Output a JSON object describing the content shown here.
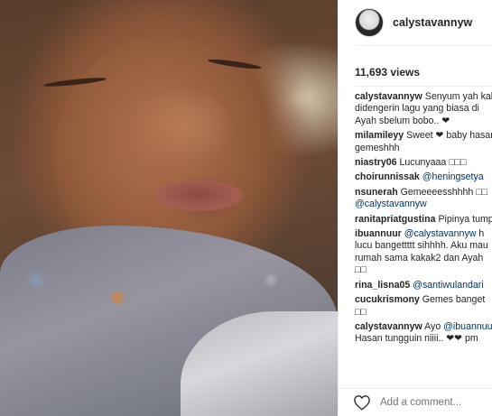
{
  "post": {
    "username": "calystavannyw",
    "views": "11,693 views"
  },
  "comments": [
    {
      "user": "calystavannyw",
      "lines": [
        "Senyum yah kalau",
        "didengerin lagu yang biasa di",
        "Ayah sbelum bobo.. ❤"
      ]
    },
    {
      "user": "milamileyy",
      "lines": [
        "Sweet ❤ baby hasan",
        "gemeshhh"
      ]
    },
    {
      "user": "niastry06",
      "lines": [
        "Lucunyaaa □□□"
      ]
    },
    {
      "user": "choirunnissak",
      "lines": [
        "@heningsetya"
      ],
      "mention": true
    },
    {
      "user": "nsunerah",
      "lines": [
        "Gemeeeesshhhh □□",
        "@calystavannyw"
      ],
      "mention_line": 1
    },
    {
      "user": "ranitapriatgustina",
      "lines": [
        "Pipinya tumpah"
      ]
    },
    {
      "user": "ibuannuur",
      "lines": [
        "@calystavannyw h",
        "lucu bangettttt sihhhh. Aku mau",
        "rumah sama kakak2 dan Ayah",
        "□□"
      ],
      "mention_line": 0
    },
    {
      "user": "rina_lisna05",
      "lines": [
        "@santiwulandari"
      ],
      "mention": true
    },
    {
      "user": "cucukrismony",
      "lines": [
        "Gemes banget",
        "□□"
      ]
    },
    {
      "user": "calystavannyw",
      "lines": [
        "Ayo @ibuannuur",
        "Hasan tungguin niiii.. ❤❤ pm"
      ]
    }
  ],
  "footer": {
    "heart_icon": "heart-outline-icon",
    "add_comment_placeholder": "Add a comment..."
  },
  "colors": {
    "mention": "#003569",
    "placeholder": "#a0a0a0",
    "text": "#262626"
  }
}
